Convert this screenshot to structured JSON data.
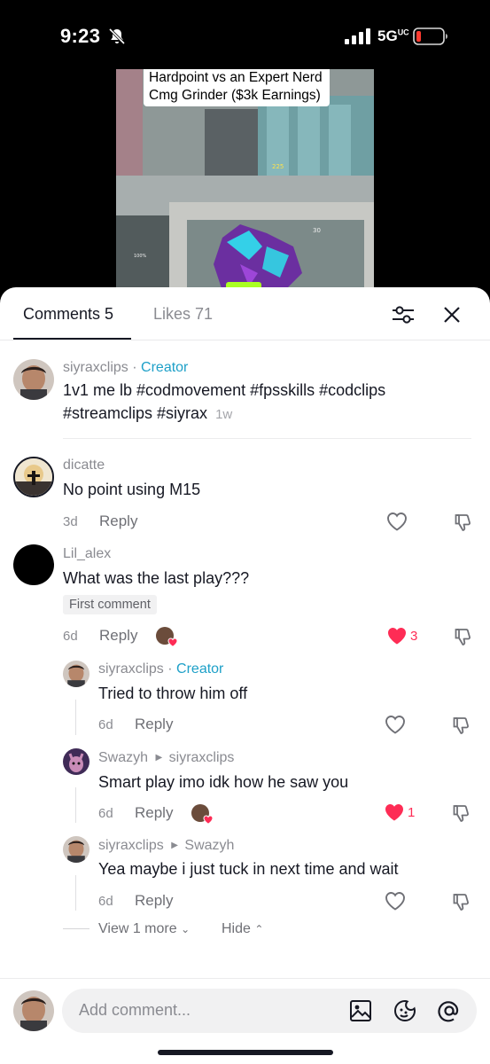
{
  "status_bar": {
    "time": "9:23",
    "network": "5G",
    "network_sup": "UC"
  },
  "video": {
    "caption_line1": "Hardpoint vs an Expert Nerd",
    "caption_line2": "Cmg Grinder ($3k Earnings)"
  },
  "tabs": {
    "comments": "Comments 5",
    "likes": "Likes 71"
  },
  "post": {
    "username": "siyraxclips",
    "separator": "·",
    "creator_label": "Creator",
    "text_line1": "1v1 me lb #codmovement #fpsskills #codclips",
    "text_line2": "#streamclips #siyrax",
    "age": "1w"
  },
  "comments": [
    {
      "username": "dicatte",
      "text": "No point using M15",
      "date": "3d",
      "reply": "Reply"
    },
    {
      "username": "Lil_alex",
      "text": "What was the last play???",
      "badge": "First comment",
      "date": "6d",
      "reply": "Reply",
      "likes": "3"
    }
  ],
  "replies": [
    {
      "username": "siyraxclips",
      "separator": "·",
      "creator_label": "Creator",
      "text": "Tried to throw him off",
      "date": "6d",
      "reply": "Reply"
    },
    {
      "username": "Swazyh",
      "reply_to": "siyraxclips",
      "text": "Smart play imo idk how he saw you",
      "date": "6d",
      "reply": "Reply",
      "likes": "1"
    },
    {
      "username": "siyraxclips",
      "reply_to": "Swazyh",
      "text": "Yea maybe i just tuck in next time and wait",
      "date": "6d",
      "reply": "Reply"
    }
  ],
  "thread_controls": {
    "view_more": "View 1 more",
    "hide": "Hide"
  },
  "input": {
    "placeholder": "Add comment..."
  },
  "colors": {
    "accent_creator": "#1ea0c8",
    "like_red": "#fe2c55",
    "text": "#161823",
    "muted": "#8a8b91"
  }
}
